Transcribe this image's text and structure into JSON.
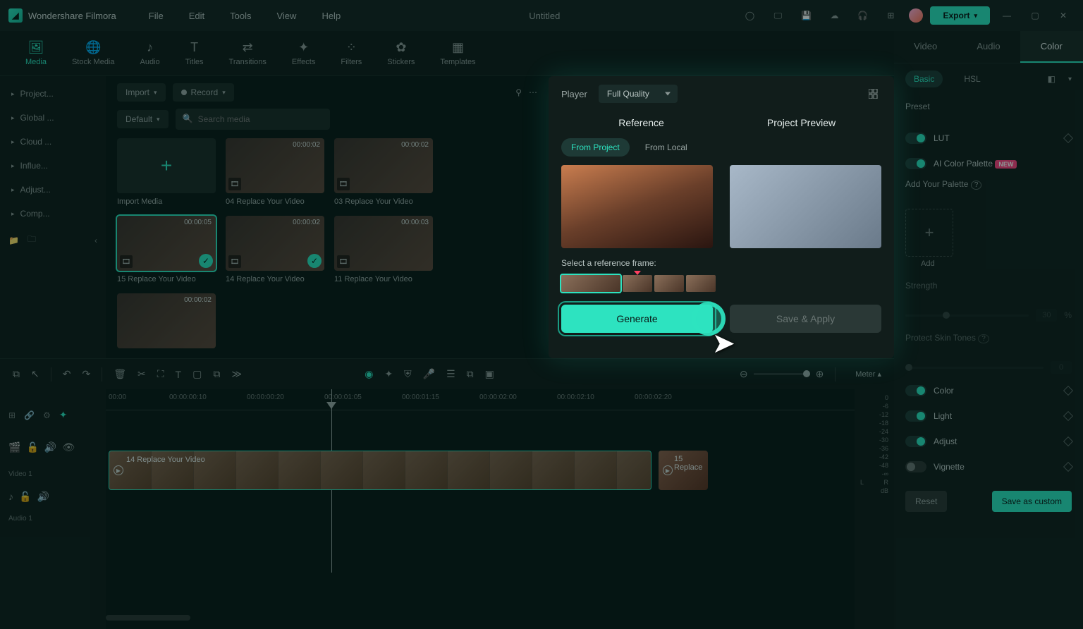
{
  "app": {
    "name": "Wondershare Filmora",
    "title": "Untitled",
    "export": "Export"
  },
  "menu": [
    "File",
    "Edit",
    "Tools",
    "View",
    "Help"
  ],
  "tabs": [
    {
      "icon": "🖼",
      "label": "Media",
      "active": true
    },
    {
      "icon": "🌐",
      "label": "Stock Media"
    },
    {
      "icon": "♪",
      "label": "Audio"
    },
    {
      "icon": "T",
      "label": "Titles"
    },
    {
      "icon": "⇄",
      "label": "Transitions"
    },
    {
      "icon": "✦",
      "label": "Effects"
    },
    {
      "icon": "⁘",
      "label": "Filters"
    },
    {
      "icon": "✿",
      "label": "Stickers"
    },
    {
      "icon": "▦",
      "label": "Templates"
    }
  ],
  "tree": [
    "Project...",
    "Global ...",
    "Cloud ...",
    "Influe...",
    "Adjust...",
    "Comp..."
  ],
  "importBtn": "Import",
  "recordBtn": "Record",
  "sortBtn": "Default",
  "searchPh": "Search media",
  "media": [
    {
      "import": true,
      "label": "Import Media"
    },
    {
      "dur": "00:00:02",
      "label": "04 Replace Your Video"
    },
    {
      "dur": "00:00:02",
      "label": "03 Replace Your Video"
    },
    {
      "dur": "00:00:05",
      "label": "15 Replace Your Video",
      "sel": true,
      "check": true
    },
    {
      "dur": "00:00:02",
      "label": "14 Replace Your Video",
      "check": true
    },
    {
      "dur": "00:00:03",
      "label": "11 Replace Your Video"
    },
    {
      "dur": "00:00:02",
      "label": ""
    }
  ],
  "player": {
    "label": "Player",
    "quality": "Full Quality",
    "h1": "Reference",
    "h2": "Project Preview",
    "tab1": "From Project",
    "tab2": "From Local",
    "selFrame": "Select a reference frame:",
    "generate": "Generate",
    "saveApply": "Save & Apply"
  },
  "right": {
    "tabs": [
      "Video",
      "Audio",
      "Color"
    ],
    "sub": [
      "Basic",
      "HSL"
    ],
    "preset": "Preset",
    "lut": "LUT",
    "aicolor": "AI Color Palette",
    "new": "NEW",
    "addPal": "Add Your Palette",
    "add": "Add",
    "strength": "Strength",
    "strengthVal": "30",
    "pct": "%",
    "skin": "Protect Skin Tones",
    "skinVal": "0",
    "color": "Color",
    "light": "Light",
    "adjust": "Adjust",
    "vignette": "Vignette",
    "reset": "Reset",
    "saveCustom": "Save as custom"
  },
  "timeline": {
    "ticks": [
      "00:00",
      "00:00:00:10",
      "00:00:00:20",
      "00:00:01:05",
      "00:00:01:15",
      "00:00:02:00",
      "00:00:02:10",
      "00:00:02:20"
    ],
    "clip1": "14 Replace Your Video",
    "clip2": "15 Replace",
    "video1": "Video 1",
    "audio1": "Audio 1",
    "meter": "Meter",
    "levels": [
      "0",
      "-6",
      "-12",
      "-18",
      "-24",
      "-30",
      "-36",
      "-42",
      "-48",
      "-∞"
    ],
    "lr": {
      "l": "L",
      "r": "R",
      "db": "dB"
    }
  }
}
